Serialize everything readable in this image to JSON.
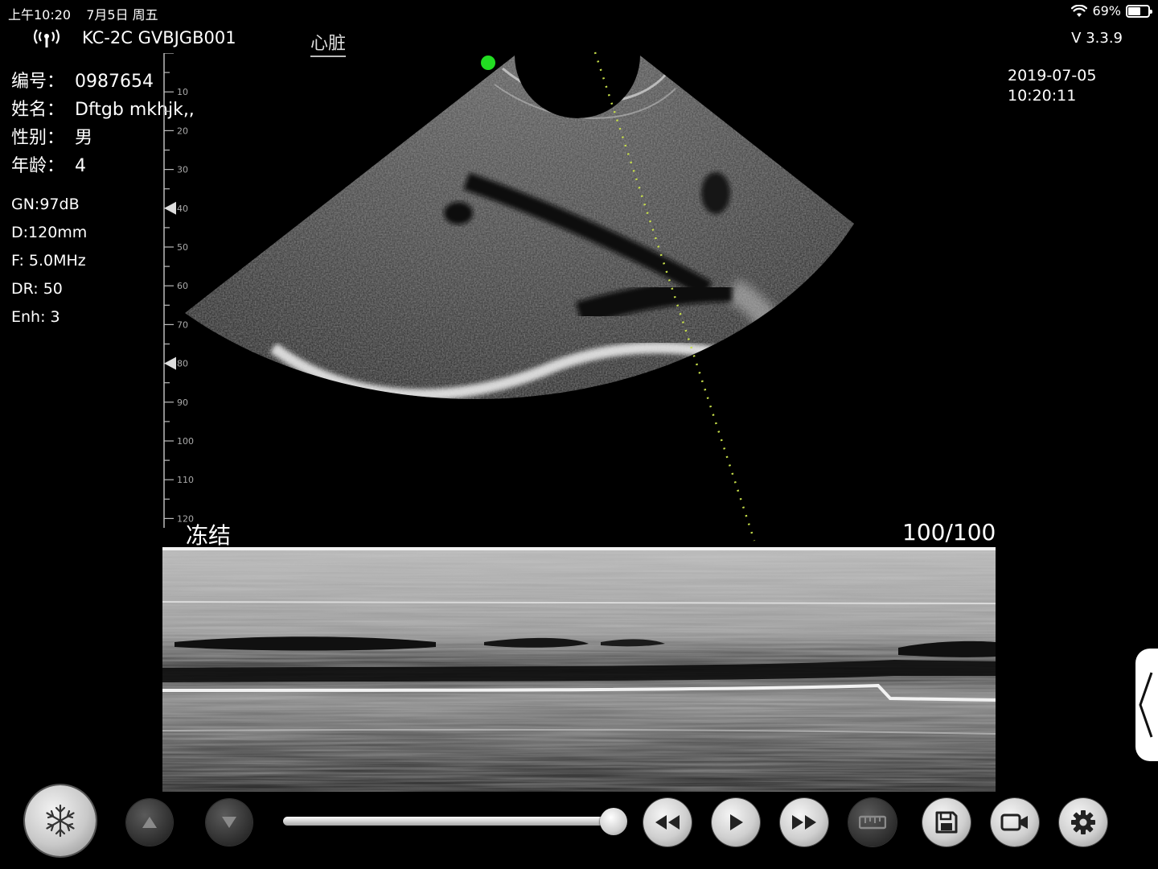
{
  "status_bar": {
    "time": "上午10:20",
    "date": "7月5日 周五",
    "battery_percent": "69%",
    "battery_level": 0.69
  },
  "header": {
    "device_id": "KC-2C GVBJGB001",
    "exam_mode": "心脏",
    "version": "V 3.3.9",
    "date": "2019-07-05",
    "time": "10:20:11"
  },
  "patient": {
    "id_label": "编号：",
    "id_value": "0987654",
    "name_label": "姓名：",
    "name_value": "Dftgb mkhjk,,",
    "sex_label": "性别：",
    "sex_value": "男",
    "age_label": "年龄：",
    "age_value": "4"
  },
  "params": {
    "gain": "GN:97dB",
    "depth": "D:120mm",
    "frequency": "F: 5.0MHz",
    "dynamic_range": "DR: 50",
    "enhance": "Enh: 3"
  },
  "ruler": {
    "labels": [
      "10",
      "20",
      "30",
      "40",
      "50",
      "60",
      "70",
      "80",
      "90",
      "100",
      "110",
      "120"
    ],
    "focus_markers": [
      "40",
      "80"
    ]
  },
  "image": {
    "freeze_label": "冻结",
    "frame_counter": "100/100"
  },
  "playback": {
    "position": 1.0
  },
  "icons": {
    "signal": "wireless-signal-icon",
    "wifi": "wifi-icon",
    "freeze": "snowflake-icon",
    "up": "triangle-up-icon",
    "down": "triangle-down-icon",
    "rewind": "rewind-icon",
    "play": "play-icon",
    "forward": "fast-forward-icon",
    "measure": "ruler-icon",
    "save": "save-icon",
    "record": "video-camera-icon",
    "settings": "gear-icon"
  },
  "colors": {
    "background": "#000000",
    "probe_marker": "#22dd22",
    "mline": "#c8e04a"
  }
}
